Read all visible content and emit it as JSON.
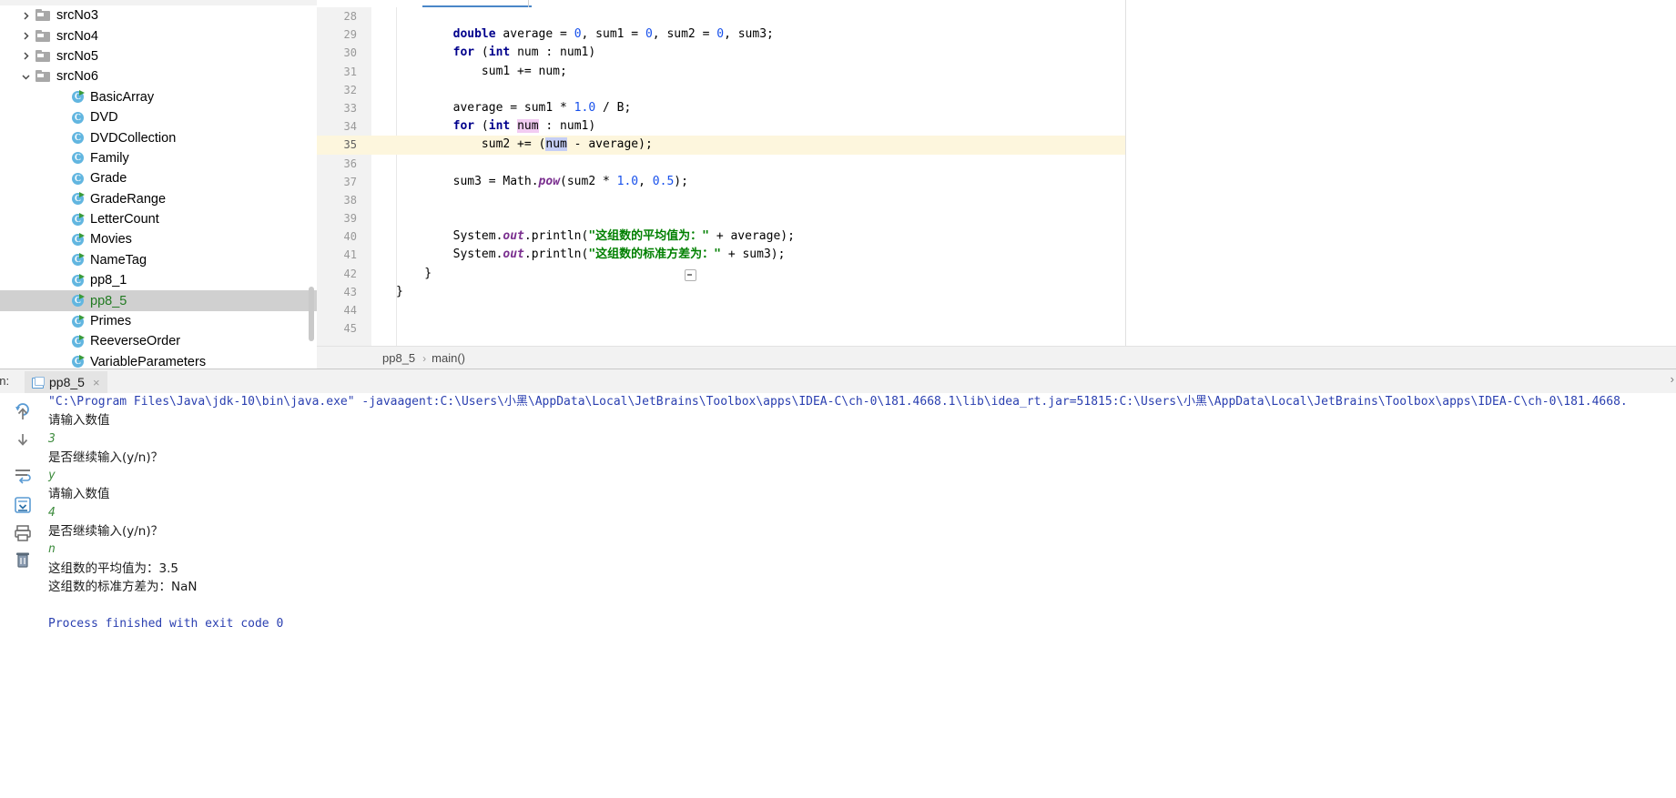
{
  "project_tree": {
    "items": [
      {
        "label": "srcNo3",
        "type": "folder",
        "expanded": false,
        "twisty": "chevron-right-icon",
        "indent": 0,
        "selected": false
      },
      {
        "label": "srcNo4",
        "type": "folder",
        "expanded": false,
        "twisty": "chevron-right-icon",
        "indent": 0,
        "selected": false
      },
      {
        "label": "srcNo5",
        "type": "folder",
        "expanded": false,
        "twisty": "chevron-right-icon",
        "indent": 0,
        "selected": false
      },
      {
        "label": "srcNo6",
        "type": "folder",
        "expanded": true,
        "twisty": "chevron-down-icon",
        "indent": 0,
        "selected": false
      },
      {
        "label": "BasicArray",
        "type": "class",
        "runnable": true,
        "indent": 1,
        "selected": false
      },
      {
        "label": "DVD",
        "type": "class",
        "runnable": false,
        "indent": 1,
        "selected": false
      },
      {
        "label": "DVDCollection",
        "type": "class",
        "runnable": false,
        "indent": 1,
        "selected": false
      },
      {
        "label": "Family",
        "type": "class",
        "runnable": false,
        "indent": 1,
        "selected": false
      },
      {
        "label": "Grade",
        "type": "class",
        "runnable": false,
        "indent": 1,
        "selected": false
      },
      {
        "label": "GradeRange",
        "type": "class",
        "runnable": true,
        "indent": 1,
        "selected": false
      },
      {
        "label": "LetterCount",
        "type": "class",
        "runnable": true,
        "indent": 1,
        "selected": false
      },
      {
        "label": "Movies",
        "type": "class",
        "runnable": true,
        "indent": 1,
        "selected": false
      },
      {
        "label": "NameTag",
        "type": "class",
        "runnable": true,
        "indent": 1,
        "selected": false
      },
      {
        "label": "pp8_1",
        "type": "class",
        "runnable": true,
        "indent": 1,
        "selected": false
      },
      {
        "label": "pp8_5",
        "type": "class",
        "runnable": true,
        "indent": 1,
        "selected": true
      },
      {
        "label": "Primes",
        "type": "class",
        "runnable": true,
        "indent": 1,
        "selected": false
      },
      {
        "label": "ReeverseOrder",
        "type": "class",
        "runnable": true,
        "indent": 1,
        "selected": false
      },
      {
        "label": "VariableParameters",
        "type": "class",
        "runnable": true,
        "indent": 1,
        "selected": false
      }
    ],
    "class_icon_letter": "C"
  },
  "editor": {
    "first_line_number": 28,
    "current_line_number": 35,
    "line_numbers": [
      28,
      29,
      30,
      31,
      32,
      33,
      34,
      35,
      36,
      37,
      38,
      39,
      40,
      41,
      42,
      43,
      44,
      45
    ],
    "lines": [
      {
        "n": 28,
        "tokens": []
      },
      {
        "n": 29,
        "tokens": [
          {
            "t": "        ",
            "c": "plain"
          },
          {
            "t": "double",
            "c": "kw"
          },
          {
            "t": " average = ",
            "c": "plain"
          },
          {
            "t": "0",
            "c": "num"
          },
          {
            "t": ", sum1 = ",
            "c": "plain"
          },
          {
            "t": "0",
            "c": "num"
          },
          {
            "t": ", sum2 = ",
            "c": "plain"
          },
          {
            "t": "0",
            "c": "num"
          },
          {
            "t": ", sum3;",
            "c": "plain"
          }
        ]
      },
      {
        "n": 30,
        "tokens": [
          {
            "t": "        ",
            "c": "plain"
          },
          {
            "t": "for",
            "c": "kw"
          },
          {
            "t": " (",
            "c": "plain"
          },
          {
            "t": "int",
            "c": "kw"
          },
          {
            "t": " num : num1)",
            "c": "plain"
          }
        ]
      },
      {
        "n": 31,
        "tokens": [
          {
            "t": "            sum1 += num;",
            "c": "plain"
          }
        ]
      },
      {
        "n": 32,
        "tokens": []
      },
      {
        "n": 33,
        "tokens": [
          {
            "t": "        average = sum1 * ",
            "c": "plain"
          },
          {
            "t": "1.0",
            "c": "num"
          },
          {
            "t": " / B;",
            "c": "plain"
          }
        ]
      },
      {
        "n": 34,
        "tokens": [
          {
            "t": "        ",
            "c": "plain"
          },
          {
            "t": "for",
            "c": "kw"
          },
          {
            "t": " (",
            "c": "plain"
          },
          {
            "t": "int",
            "c": "kw"
          },
          {
            "t": " ",
            "c": "plain"
          },
          {
            "t": "num",
            "c": "ident-pink"
          },
          {
            "t": " : num1)",
            "c": "plain"
          }
        ]
      },
      {
        "n": 35,
        "tokens": [
          {
            "t": "            sum2 += (",
            "c": "plain"
          },
          {
            "t": "num",
            "c": "ident-blue"
          },
          {
            "t": " - average);",
            "c": "plain"
          }
        ]
      },
      {
        "n": 36,
        "tokens": []
      },
      {
        "n": 37,
        "tokens": [
          {
            "t": "        sum3 = Math.",
            "c": "plain"
          },
          {
            "t": "pow",
            "c": "stat"
          },
          {
            "t": "(sum2 * ",
            "c": "plain"
          },
          {
            "t": "1.0",
            "c": "num"
          },
          {
            "t": ", ",
            "c": "plain"
          },
          {
            "t": "0.5",
            "c": "num"
          },
          {
            "t": ");",
            "c": "plain"
          }
        ]
      },
      {
        "n": 38,
        "tokens": []
      },
      {
        "n": 39,
        "tokens": []
      },
      {
        "n": 40,
        "tokens": [
          {
            "t": "        System.",
            "c": "plain"
          },
          {
            "t": "out",
            "c": "stat"
          },
          {
            "t": ".println(",
            "c": "plain"
          },
          {
            "t": "\"这组数的平均值为：\"",
            "c": "str"
          },
          {
            "t": " + average);",
            "c": "plain"
          }
        ]
      },
      {
        "n": 41,
        "tokens": [
          {
            "t": "        System.",
            "c": "plain"
          },
          {
            "t": "out",
            "c": "stat"
          },
          {
            "t": ".println(",
            "c": "plain"
          },
          {
            "t": "\"这组数的标准方差为：\"",
            "c": "str"
          },
          {
            "t": " + sum3);",
            "c": "plain"
          }
        ]
      },
      {
        "n": 42,
        "tokens": [
          {
            "t": "    }",
            "c": "plain"
          }
        ]
      },
      {
        "n": 43,
        "tokens": [
          {
            "t": "}",
            "c": "plain"
          }
        ]
      },
      {
        "n": 44,
        "tokens": []
      },
      {
        "n": 45,
        "tokens": []
      }
    ],
    "breadcrumb": {
      "class_name": "pp8_5",
      "separator": "›",
      "method_name": "main()"
    }
  },
  "run_window": {
    "title": "un:",
    "tab": {
      "label": "pp8_5",
      "close_glyph": "×",
      "icon": "run-configuration-icon"
    },
    "toolbar_buttons": [
      {
        "name": "rerun-icon",
        "glyph": "rerun"
      },
      {
        "name": "arrow-up-icon",
        "glyph": "up"
      },
      {
        "name": "arrow-down-icon",
        "glyph": "down"
      },
      {
        "name": "soft-wrap-icon",
        "glyph": "wrap"
      },
      {
        "name": "scroll-to-end-icon",
        "glyph": "scroll-end"
      },
      {
        "name": "print-icon",
        "glyph": "print"
      },
      {
        "name": "trash-icon",
        "glyph": "trash"
      }
    ],
    "right_arrow_glyph": "›",
    "console_lines": [
      {
        "text": "\"C:\\Program Files\\Java\\jdk-10\\bin\\java.exe\" -javaagent:C:\\Users\\小黑\\AppData\\Local\\JetBrains\\Toolbox\\apps\\IDEA-C\\ch-0\\181.4668.1\\lib\\idea_rt.jar=51815:C:\\Users\\小黑\\AppData\\Local\\JetBrains\\Toolbox\\apps\\IDEA-C\\ch-0\\181.4668.",
        "kind": "cmd"
      },
      {
        "text": "请输入数值",
        "kind": "out"
      },
      {
        "text": "3",
        "kind": "in"
      },
      {
        "text": "是否继续输入(y/n)？",
        "kind": "out"
      },
      {
        "text": "y",
        "kind": "in"
      },
      {
        "text": "请输入数值",
        "kind": "out"
      },
      {
        "text": "4",
        "kind": "in"
      },
      {
        "text": "是否继续输入(y/n)？",
        "kind": "out"
      },
      {
        "text": "n",
        "kind": "in"
      },
      {
        "text": "这组数的平均值为：3.5",
        "kind": "out"
      },
      {
        "text": "这组数的标准方差为：NaN",
        "kind": "out"
      },
      {
        "text": "",
        "kind": "out"
      },
      {
        "text": "Process finished with exit code 0",
        "kind": "fin"
      }
    ]
  },
  "colors": {
    "keyword": "#00008c",
    "number": "#1750eb",
    "string": "#008000",
    "static_member": "#7a2f8f",
    "current_line_bg": "#fdf6dd",
    "selection_bg": "#d0d0d0",
    "selected_text": "#217a21",
    "console_command": "#2a3fb0",
    "console_input": "#3e8c3e",
    "toolwindow_bg": "#f2f2f2"
  }
}
